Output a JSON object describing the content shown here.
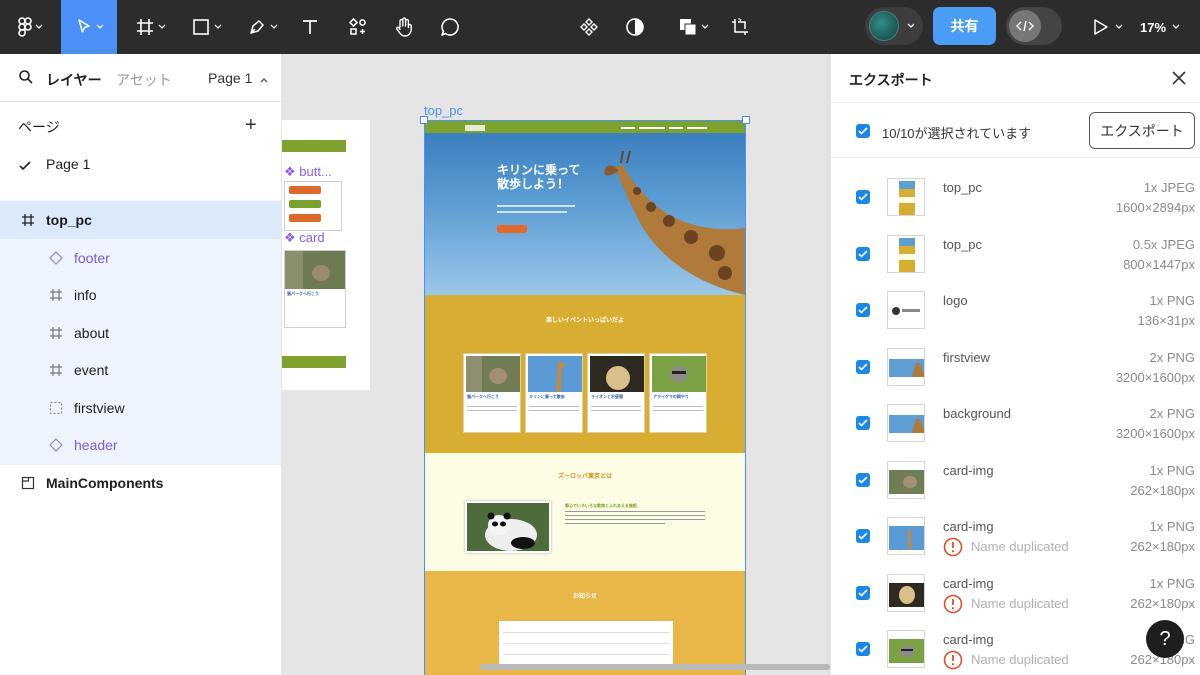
{
  "toolbar": {
    "share_label": "共有",
    "zoom_label": "17%",
    "icons": [
      "figma-menu-icon",
      "move-tool-icon",
      "frame-tool-icon",
      "shape-tool-icon",
      "pen-tool-icon",
      "text-tool-icon",
      "components-tool-icon",
      "hand-tool-icon",
      "comment-tool-icon",
      "component-icon",
      "contrast-icon",
      "boolean-icon",
      "crop-icon",
      "dev-mode-icon",
      "play-icon"
    ]
  },
  "left_panel": {
    "layers_tab": "レイヤー",
    "assets_tab": "アセット",
    "page_selector": "Page 1",
    "pages_header": "ページ",
    "pages": [
      "Page 1"
    ],
    "layers": [
      {
        "label": "top_pc",
        "icon": "frame-icon"
      },
      {
        "label": "footer",
        "icon": "component-instance-icon"
      },
      {
        "label": "info",
        "icon": "frame-icon"
      },
      {
        "label": "about",
        "icon": "frame-icon"
      },
      {
        "label": "event",
        "icon": "frame-icon"
      },
      {
        "label": "firstview",
        "icon": "section-icon"
      },
      {
        "label": "header",
        "icon": "component-instance-icon"
      },
      {
        "label": "MainComponents",
        "icon": "page-section-icon"
      }
    ]
  },
  "canvas": {
    "frame_label": "top_pc",
    "main_components": {
      "button_title": "butt...",
      "card_title": "card",
      "card_caption": "猫パークへ行こう"
    },
    "design": {
      "hero_title_line1": "キリンに乗って",
      "hero_title_line2": "散歩しよう！",
      "event_title": "楽しいイベントいっぱいだよ",
      "cards": [
        "猫パークへ行こう",
        "キリンに乗って散歩",
        "ライオンとお昼寝",
        "アライグマの餌やり"
      ],
      "about_title": "ズーロッパ東京とは",
      "about_sub": "都心でいろいろな動物とふれあえる施設",
      "info_title": "お知らせ"
    }
  },
  "export_panel": {
    "title": "エクスポート",
    "selected_text": "10/10が選択されています",
    "export_button": "エクスポート",
    "duplicate_warning": "Name duplicated",
    "items": [
      {
        "name": "top_pc",
        "scale": "1x JPEG",
        "size": "1600×2894px",
        "duplicate": false
      },
      {
        "name": "top_pc",
        "scale": "0.5x JPEG",
        "size": "800×1447px",
        "duplicate": false
      },
      {
        "name": "logo",
        "scale": "1x PNG",
        "size": "136×31px",
        "duplicate": false
      },
      {
        "name": "firstview",
        "scale": "2x PNG",
        "size": "3200×1600px",
        "duplicate": false
      },
      {
        "name": "background",
        "scale": "2x PNG",
        "size": "3200×1600px",
        "duplicate": false
      },
      {
        "name": "card-img",
        "scale": "1x PNG",
        "size": "262×180px",
        "duplicate": false
      },
      {
        "name": "card-img",
        "scale": "1x PNG",
        "size": "262×180px",
        "duplicate": true
      },
      {
        "name": "card-img",
        "scale": "1x PNG",
        "size": "262×180px",
        "duplicate": true
      },
      {
        "name": "card-img",
        "scale": "1x PNG",
        "size": "262×180px",
        "duplicate": true
      }
    ]
  },
  "help_label": "?",
  "colors": {
    "toolbar_bg": "#2c2c2c",
    "accent_blue": "#4a90f6",
    "share_blue": "#4b9cf5",
    "checkbox_blue": "#1b88e6",
    "header_green": "#7aa22d",
    "event_gold": "#d7ae32",
    "about_cream": "#fdfce4",
    "info_orange": "#e9b648"
  }
}
